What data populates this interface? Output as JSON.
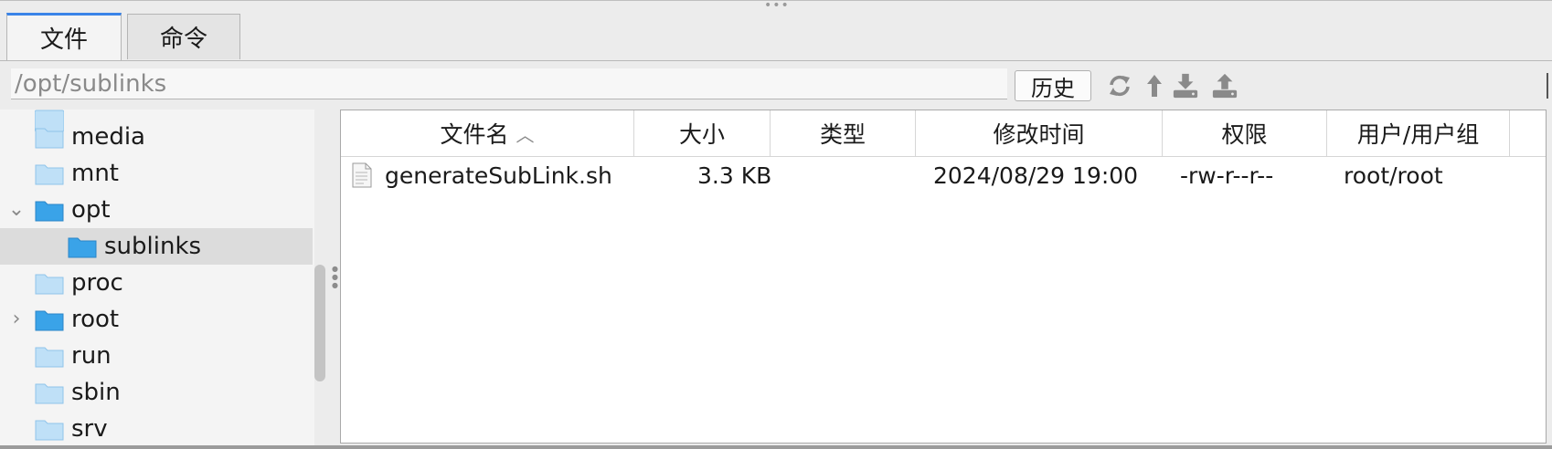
{
  "tabs": [
    {
      "label": "文件",
      "active": true
    },
    {
      "label": "命令",
      "active": false
    }
  ],
  "path_bar": {
    "value": "/opt/sublinks",
    "history_label": "历史",
    "icons": [
      "refresh-icon",
      "up-arrow-icon",
      "download-icon",
      "upload-icon"
    ]
  },
  "tree": {
    "items": [
      {
        "label": "media",
        "expanded": null,
        "selected": false
      },
      {
        "label": "mnt",
        "expanded": null,
        "selected": false
      },
      {
        "label": "opt",
        "expanded": true,
        "selected": false
      },
      {
        "label": "sublinks",
        "expanded": null,
        "selected": true
      },
      {
        "label": "proc",
        "expanded": null,
        "selected": false
      },
      {
        "label": "root",
        "expanded": false,
        "selected": false
      },
      {
        "label": "run",
        "expanded": null,
        "selected": false
      },
      {
        "label": "sbin",
        "expanded": null,
        "selected": false
      },
      {
        "label": "srv",
        "expanded": null,
        "selected": false
      }
    ]
  },
  "table": {
    "columns": [
      "文件名",
      "大小",
      "类型",
      "修改时间",
      "权限",
      "用户/用户组"
    ],
    "sort_indicator": "chevron-up-icon",
    "rows": [
      {
        "name": "generateSubLink.sh",
        "size": "3.3 KB",
        "type": "",
        "modified": "2024/08/29 19:00",
        "permissions": "-rw-r--r--",
        "owner": "root/root"
      }
    ]
  },
  "colors": {
    "accent": "#3a84e8",
    "folder_blue": "#3aa3e8",
    "folder_light": "#bfe0f7"
  }
}
